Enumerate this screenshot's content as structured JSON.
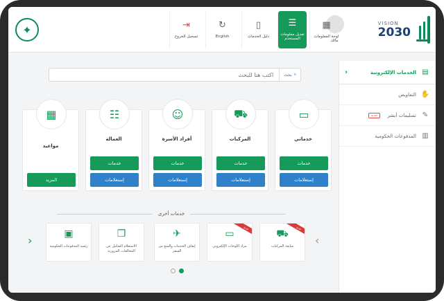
{
  "header": {
    "vision": {
      "line1": "VISION",
      "line2": "2030"
    },
    "nav": [
      {
        "label": "مالك",
        "icon": "user-icon"
      },
      {
        "label": "لوحة المعلومات",
        "icon": "dashboard-icon"
      },
      {
        "label": "تعديل معلومات المستخدم",
        "icon": "user-edit-icon"
      },
      {
        "label": "دليل الخدمات",
        "icon": "book-icon"
      },
      {
        "label": "English",
        "icon": "language-icon"
      },
      {
        "label": "تسجيل الخروج",
        "icon": "logout-icon"
      }
    ]
  },
  "sidebar": {
    "items": [
      {
        "label": "الخدمات الإلكترونية",
        "icon": "services-icon"
      },
      {
        "label": "التفاويض",
        "icon": "handshake-icon"
      },
      {
        "label": "تسليمات أبشر",
        "icon": "box-icon",
        "badge": "جديد"
      },
      {
        "label": "المدفوعات الحكومية",
        "icon": "payment-icon"
      }
    ]
  },
  "search": {
    "button_label": "بحث",
    "placeholder": "اكتب هنا للبحث"
  },
  "cards": [
    {
      "title": "خدماتي",
      "icon": "laptop-icon",
      "primary": "خدمات",
      "secondary": "إستعلامات"
    },
    {
      "title": "المركبات",
      "icon": "car-icon",
      "primary": "خدمات",
      "secondary": "إستعلامات"
    },
    {
      "title": "أفراد الأسرة",
      "icon": "family-icon",
      "primary": "خدمات",
      "secondary": "إستعلامات"
    },
    {
      "title": "العمالة",
      "icon": "workers-icon",
      "primary": "خدمات",
      "secondary": "إستعلامات"
    },
    {
      "title": "مواعيد",
      "icon": "calendar-icon",
      "primary": "المزيد"
    }
  ],
  "other_services": {
    "title": "خدمات أخرى",
    "items": [
      {
        "label": "مبايعة المركبات",
        "icon": "car-deal-icon",
        "ribbon": "جديد"
      },
      {
        "label": "مزاد اللوحات الإلكتروني",
        "icon": "plate-icon",
        "ribbon": "جديد"
      },
      {
        "label": "إيقاف الخدمات والمنع من السفر",
        "icon": "no-travel-icon"
      },
      {
        "label": "الاستعلام الشامل عن المخالفات المرورية",
        "icon": "documents-icon"
      },
      {
        "label": "رصيد المدفوعات الحكومية",
        "icon": "atm-icon"
      }
    ]
  }
}
